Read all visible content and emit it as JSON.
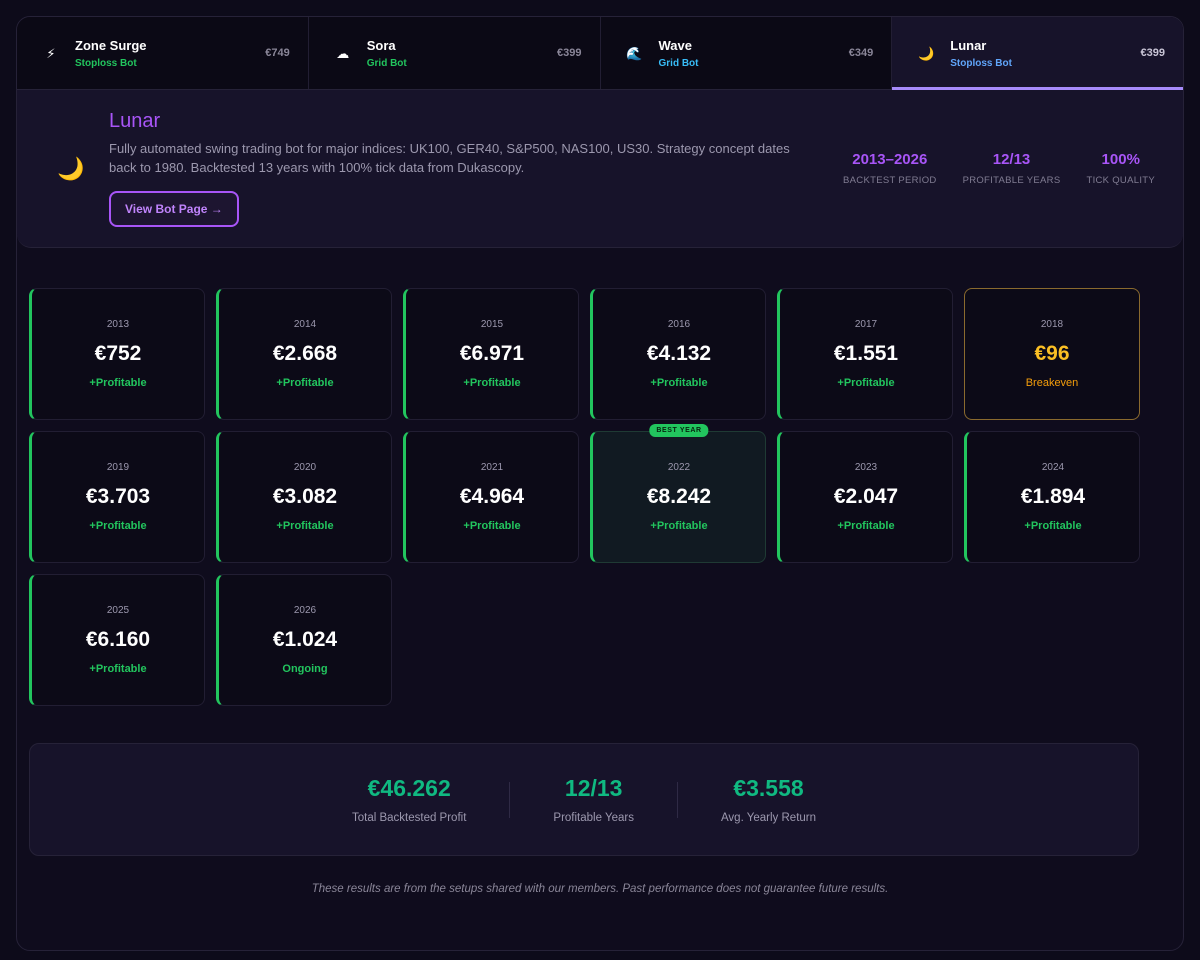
{
  "tabs": [
    {
      "name": "Zone Surge",
      "type": "Stoploss Bot",
      "type_color": "#22c55e",
      "price": "€749",
      "icon": "lightning-icon",
      "glyph": "⚡",
      "active": false
    },
    {
      "name": "Sora",
      "type": "Grid Bot",
      "type_color": "#22c55e",
      "price": "€399",
      "icon": "cloud-icon",
      "glyph": "☁",
      "active": false
    },
    {
      "name": "Wave",
      "type": "Grid Bot",
      "type_color": "#38bdf8",
      "price": "€349",
      "icon": "wave-icon",
      "glyph": "🌊",
      "active": false
    },
    {
      "name": "Lunar",
      "type": "Stoploss Bot",
      "type_color": "#60a5fa",
      "price": "€399",
      "icon": "moon-icon",
      "glyph": "🌙",
      "active": true
    }
  ],
  "info": {
    "title": "Lunar",
    "description": "Fully automated swing trading bot for major indices: UK100, GER40, S&P500, NAS100, US30. Strategy concept dates back to 1980. Backtested 13 years with 100% tick data from Dukascopy.",
    "button_label": "View Bot Page →",
    "icon": "moon-icon",
    "glyph": "🌙",
    "stats": [
      {
        "value": "2013–2026",
        "label": "BACKTEST PERIOD"
      },
      {
        "value": "12/13",
        "label": "PROFITABLE YEARS"
      },
      {
        "value": "100%",
        "label": "TICK QUALITY"
      }
    ]
  },
  "years": [
    {
      "year": "2013",
      "value": "€752",
      "status": "+Profitable",
      "kind": "profit"
    },
    {
      "year": "2014",
      "value": "€2.668",
      "status": "+Profitable",
      "kind": "profit"
    },
    {
      "year": "2015",
      "value": "€6.971",
      "status": "+Profitable",
      "kind": "profit"
    },
    {
      "year": "2016",
      "value": "€4.132",
      "status": "+Profitable",
      "kind": "profit"
    },
    {
      "year": "2017",
      "value": "€1.551",
      "status": "+Profitable",
      "kind": "profit"
    },
    {
      "year": "2018",
      "value": "€96",
      "status": "Breakeven",
      "kind": "neutral"
    },
    {
      "year": "2019",
      "value": "€3.703",
      "status": "+Profitable",
      "kind": "profit"
    },
    {
      "year": "2020",
      "value": "€3.082",
      "status": "+Profitable",
      "kind": "profit"
    },
    {
      "year": "2021",
      "value": "€4.964",
      "status": "+Profitable",
      "kind": "profit"
    },
    {
      "year": "2022",
      "value": "€8.242",
      "status": "+Profitable",
      "kind": "best",
      "badge": "BEST YEAR"
    },
    {
      "year": "2023",
      "value": "€2.047",
      "status": "+Profitable",
      "kind": "profit"
    },
    {
      "year": "2024",
      "value": "€1.894",
      "status": "+Profitable",
      "kind": "profit"
    },
    {
      "year": "2025",
      "value": "€6.160",
      "status": "+Profitable",
      "kind": "profit"
    },
    {
      "year": "2026",
      "value": "€1.024",
      "status": "Ongoing",
      "kind": "profit"
    }
  ],
  "summary": [
    {
      "value": "€46.262",
      "label": "Total Backtested Profit"
    },
    {
      "value": "12/13",
      "label": "Profitable Years"
    },
    {
      "value": "€3.558",
      "label": "Avg. Yearly Return"
    }
  ],
  "disclaimer": "These results are from the setups shared with our members. Past performance does not guarantee future results."
}
